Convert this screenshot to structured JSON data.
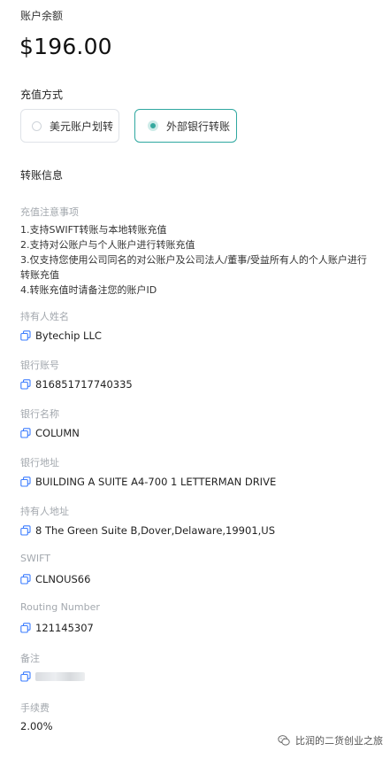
{
  "account": {
    "balance_label": "账户余额",
    "balance_value": "$196.00"
  },
  "recharge": {
    "section_title": "充值方式",
    "methods": [
      {
        "label": "美元账户划转",
        "selected": false
      },
      {
        "label": "外部银行转账",
        "selected": true
      }
    ]
  },
  "transfer_info": {
    "section_title": "转账信息",
    "notes_title": "充值注意事项",
    "notes": [
      "1.支持SWIFT转账与本地转账充值",
      "2.支持对公账户与个人账户进行转账充值",
      "3.仅支持您使用公司同名的对公账户及公司法人/董事/受益所有人的个人账户进行转账充值",
      "4.转账充值时请备注您的账户ID"
    ],
    "fields": [
      {
        "label": "持有人姓名",
        "value": "Bytechip LLC"
      },
      {
        "label": "银行账号",
        "value": "816851717740335"
      },
      {
        "label": "银行名称",
        "value": "COLUMN"
      },
      {
        "label": "银行地址",
        "value": "BUILDING A SUITE A4-700 1 LETTERMAN DRIVE"
      },
      {
        "label": "持有人地址",
        "value": "8 The Green Suite B,Dover,Delaware,19901,US"
      },
      {
        "label": "SWIFT",
        "value": "CLNOUS66"
      },
      {
        "label": "Routing Number",
        "value": "121145307"
      }
    ],
    "remark_label": "备注",
    "fee_label": "手续费",
    "fee_value": "2.00%"
  },
  "watermark": {
    "text": "比润的二货创业之旅",
    "icon": "wechat-icon"
  },
  "colors": {
    "accent": "#2fa8a0",
    "muted_label": "#a3a8ae",
    "icon_blue": "#3b7cff"
  }
}
